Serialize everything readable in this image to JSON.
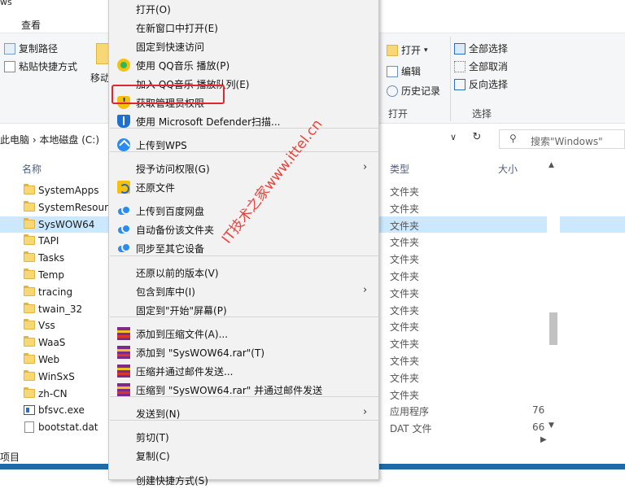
{
  "window": {
    "title_fragment": "ws"
  },
  "ribbon": {
    "tab_view": "查看",
    "clipboard": {
      "copy_path": "复制路径",
      "paste_shortcut": "粘贴快捷方式",
      "move_to": "移动"
    },
    "open_group": {
      "open": "打开",
      "edit": "编辑",
      "history": "历史记录",
      "label": "打开"
    },
    "select_group": {
      "select_all": "全部选择",
      "select_none": "全部取消",
      "invert": "反向选择",
      "label": "选择"
    }
  },
  "address": {
    "crumbs": "此电脑  ›  本地磁盘 (C:)",
    "dropdown": "∨",
    "refresh": "↻",
    "search_placeholder": "搜索\"Windows\""
  },
  "columns": {
    "name": "名称",
    "type": "类型",
    "size": "大小"
  },
  "files": [
    {
      "name": "SystemApps",
      "type": "文件夹",
      "size": "",
      "kind": "folder"
    },
    {
      "name": "SystemResources",
      "type": "文件夹",
      "size": "",
      "kind": "folder"
    },
    {
      "name": "SysWOW64",
      "type": "文件夹",
      "size": "",
      "kind": "folder",
      "selected": true
    },
    {
      "name": "TAPI",
      "type": "文件夹",
      "size": "",
      "kind": "folder"
    },
    {
      "name": "Tasks",
      "type": "文件夹",
      "size": "",
      "kind": "folder"
    },
    {
      "name": "Temp",
      "type": "文件夹",
      "size": "",
      "kind": "folder"
    },
    {
      "name": "tracing",
      "type": "文件夹",
      "size": "",
      "kind": "folder"
    },
    {
      "name": "twain_32",
      "type": "文件夹",
      "size": "",
      "kind": "folder"
    },
    {
      "name": "Vss",
      "type": "文件夹",
      "size": "",
      "kind": "folder"
    },
    {
      "name": "WaaS",
      "type": "文件夹",
      "size": "",
      "kind": "folder"
    },
    {
      "name": "Web",
      "type": "文件夹",
      "size": "",
      "kind": "folder"
    },
    {
      "name": "WinSxS",
      "type": "文件夹",
      "size": "",
      "kind": "folder"
    },
    {
      "name": "zh-CN",
      "type": "文件夹",
      "size": "",
      "kind": "folder"
    },
    {
      "name": "bfsvc.exe",
      "type": "应用程序",
      "size": "76",
      "kind": "exe"
    },
    {
      "name": "bootstat.dat",
      "type": "DAT 文件",
      "size": "66",
      "kind": "file"
    }
  ],
  "status": {
    "text": "项目"
  },
  "context_menu": {
    "items": [
      {
        "label": "打开(O)",
        "icon": ""
      },
      {
        "label": "在新窗口中打开(E)",
        "icon": ""
      },
      {
        "label": "固定到快速访问",
        "icon": ""
      },
      {
        "label": "使用 QQ音乐 播放(P)",
        "icon": "qq-music-icon"
      },
      {
        "label": "加入 QQ音乐 播放队列(E)",
        "icon": ""
      },
      {
        "label": "获取管理员权限",
        "icon": "admin-shield-icon"
      },
      {
        "label": "使用 Microsoft Defender扫描...",
        "icon": "defender-icon"
      },
      {
        "label": "上传到WPS",
        "icon": "wps-icon"
      },
      {
        "label": "授予访问权限(G)",
        "icon": "",
        "submenu": true
      },
      {
        "label": "还原文件",
        "icon": "restore-icon"
      },
      {
        "label": "上传到百度网盘",
        "icon": "baidu-cloud-icon"
      },
      {
        "label": "自动备份该文件夹",
        "icon": "baidu-cloud-icon"
      },
      {
        "label": "同步至其它设备",
        "icon": "baidu-cloud-icon"
      },
      {
        "label": "还原以前的版本(V)",
        "icon": ""
      },
      {
        "label": "包含到库中(I)",
        "icon": "",
        "submenu": true
      },
      {
        "label": "固定到\"开始\"屏幕(P)",
        "icon": ""
      },
      {
        "label": "添加到压缩文件(A)...",
        "icon": "winrar-icon"
      },
      {
        "label": "添加到 \"SysWOW64.rar\"(T)",
        "icon": "winrar-icon"
      },
      {
        "label": "压缩并通过邮件发送...",
        "icon": "winrar-icon"
      },
      {
        "label": "压缩到 \"SysWOW64.rar\" 并通过邮件发送",
        "icon": "winrar-icon"
      },
      {
        "label": "发送到(N)",
        "icon": "",
        "submenu": true
      },
      {
        "label": "剪切(T)",
        "icon": ""
      },
      {
        "label": "复制(C)",
        "icon": ""
      },
      {
        "label": "创建快捷方式(S)",
        "icon": ""
      }
    ],
    "submenu_arrow": "›"
  },
  "watermark": "IT技术之家www.ittel.cn",
  "colors": {
    "selection": "#cce8ff",
    "highlight_box": "#e0262e",
    "menu_bg": "#f2f2f2",
    "taskbar": "#1e6ba8"
  }
}
